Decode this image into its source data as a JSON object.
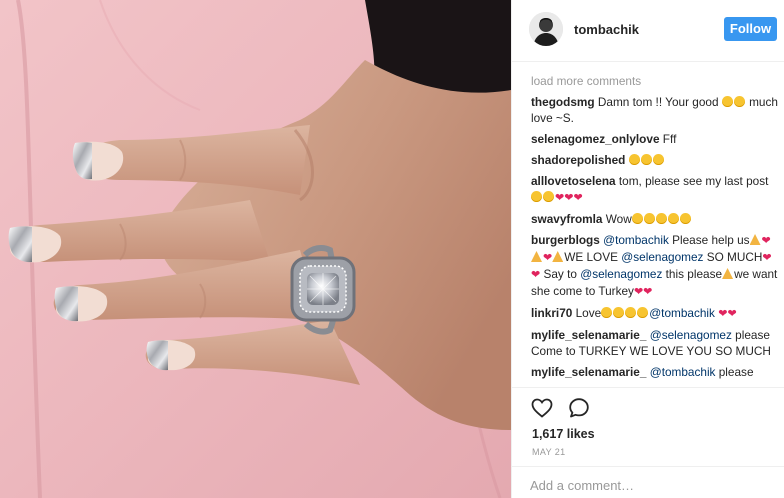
{
  "post": {
    "author": {
      "username": "tombachik",
      "avatar_icon": "profile-avatar"
    },
    "follow_label": "Follow",
    "load_more_label": "load more comments",
    "comments": [
      {
        "user": "thegodsmg",
        "parts": [
          {
            "type": "text",
            "value": "Damn tom !! Your good "
          },
          {
            "type": "emoji",
            "value": "grin-face"
          },
          {
            "type": "emoji",
            "value": "grin-face"
          },
          {
            "type": "text",
            "value": " much love ~S."
          }
        ]
      },
      {
        "user": "selenagomez_onlylove",
        "parts": [
          {
            "type": "text",
            "value": "Fff"
          }
        ]
      },
      {
        "user": "shadorepolished",
        "parts": [
          {
            "type": "emoji",
            "value": "heart-eyes-face"
          },
          {
            "type": "emoji",
            "value": "heart-eyes-face"
          },
          {
            "type": "emoji",
            "value": "heart-eyes-face"
          }
        ]
      },
      {
        "user": "alllovetoselena",
        "parts": [
          {
            "type": "text",
            "value": "tom, please see my last post"
          },
          {
            "type": "emoji",
            "value": "heart-eyes-face"
          },
          {
            "type": "emoji",
            "value": "heart-eyes-face"
          },
          {
            "type": "emoji",
            "value": "heart"
          },
          {
            "type": "emoji",
            "value": "heart"
          },
          {
            "type": "emoji",
            "value": "heart"
          }
        ]
      },
      {
        "user": "swavyfromla",
        "parts": [
          {
            "type": "text",
            "value": "Wow"
          },
          {
            "type": "emoji",
            "value": "heart-eyes-face"
          },
          {
            "type": "emoji",
            "value": "heart-eyes-face"
          },
          {
            "type": "emoji",
            "value": "heart-eyes-face"
          },
          {
            "type": "emoji",
            "value": "heart-eyes-face"
          },
          {
            "type": "emoji",
            "value": "heart-eyes-face"
          }
        ]
      },
      {
        "user": "burgerblogs",
        "parts": [
          {
            "type": "mention",
            "value": "@tombachik"
          },
          {
            "type": "text",
            "value": " Please help us"
          },
          {
            "type": "emoji",
            "value": "pray"
          },
          {
            "type": "emoji",
            "value": "heart"
          },
          {
            "type": "emoji",
            "value": "pray"
          },
          {
            "type": "emoji",
            "value": "heart"
          },
          {
            "type": "emoji",
            "value": "pray"
          },
          {
            "type": "text",
            "value": "WE LOVE "
          },
          {
            "type": "mention",
            "value": "@selenagomez"
          },
          {
            "type": "text",
            "value": " SO MUCH"
          },
          {
            "type": "emoji",
            "value": "heart"
          },
          {
            "type": "emoji",
            "value": "heart"
          },
          {
            "type": "text",
            "value": " Say to "
          },
          {
            "type": "mention",
            "value": "@selenagomez"
          },
          {
            "type": "text",
            "value": " this please"
          },
          {
            "type": "emoji",
            "value": "pray"
          },
          {
            "type": "text",
            "value": "we want she come to Turkey"
          },
          {
            "type": "emoji",
            "value": "heart"
          },
          {
            "type": "emoji",
            "value": "heart"
          }
        ]
      },
      {
        "user": "linkri70",
        "parts": [
          {
            "type": "text",
            "value": "Love"
          },
          {
            "type": "emoji",
            "value": "heart-eyes-face"
          },
          {
            "type": "emoji",
            "value": "heart-eyes-face"
          },
          {
            "type": "emoji",
            "value": "heart-eyes-face"
          },
          {
            "type": "emoji",
            "value": "heart-eyes-face"
          },
          {
            "type": "mention",
            "value": "@tombachik"
          },
          {
            "type": "text",
            "value": " "
          },
          {
            "type": "emoji",
            "value": "heart"
          },
          {
            "type": "emoji",
            "value": "heart"
          }
        ]
      },
      {
        "user": "mylife_selenamarie_",
        "parts": [
          {
            "type": "mention",
            "value": "@selenagomez"
          },
          {
            "type": "text",
            "value": " please Come to TURKEY WE LOVE YOU SO MUCH"
          }
        ]
      },
      {
        "user": "mylife_selenamarie_",
        "parts": [
          {
            "type": "mention",
            "value": "@tombachik"
          },
          {
            "type": "text",
            "value": " please"
          }
        ]
      }
    ],
    "likes_label": "1,617 likes",
    "date_label": "MAY 21",
    "add_comment_placeholder": "Add a comment…",
    "colors": {
      "follow_button": "#3897f0",
      "mention": "#003569",
      "muted_text": "#999999",
      "text": "#262626",
      "divider": "#efefef"
    }
  }
}
